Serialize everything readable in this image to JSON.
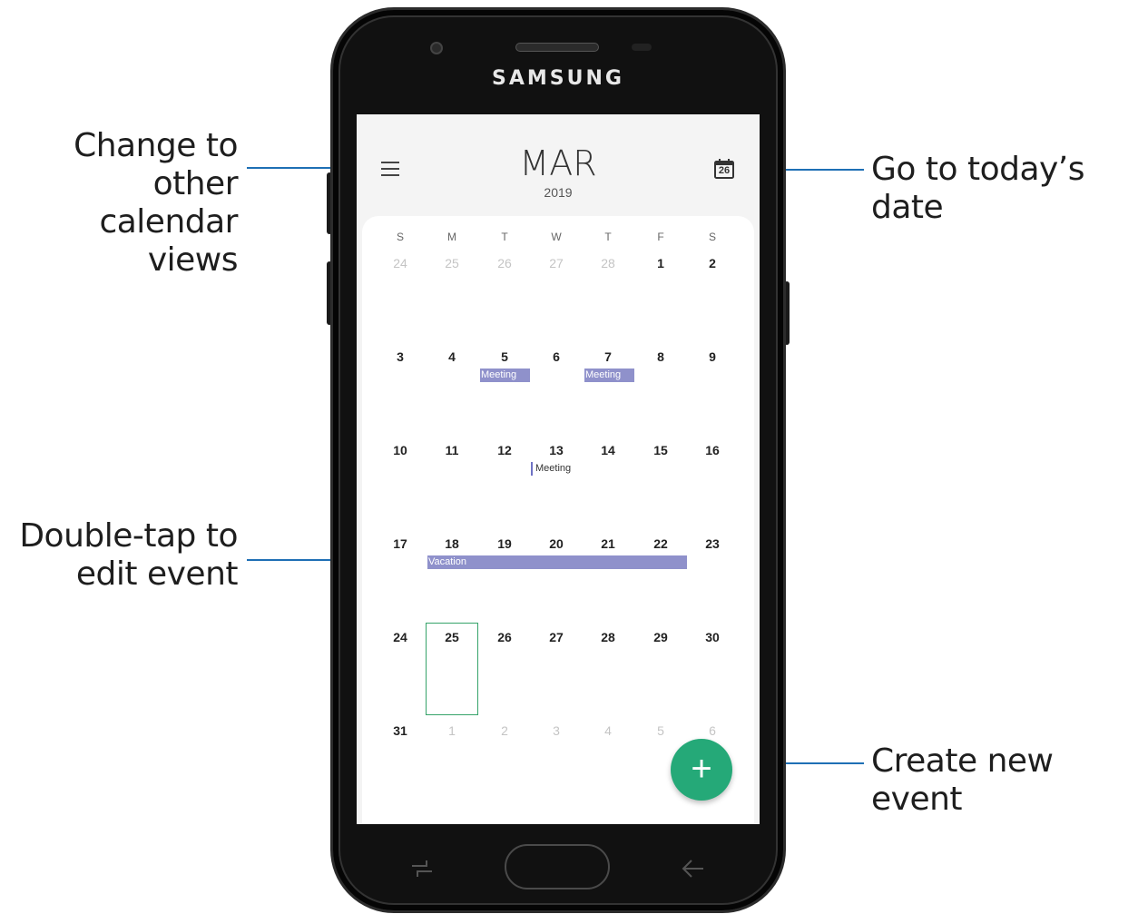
{
  "callouts": {
    "change_view": [
      "Change to other",
      "calendar views"
    ],
    "today": "Go to today’s date",
    "edit_event": [
      "Double-tap to",
      "edit event"
    ],
    "create_event": "Create new event"
  },
  "phone": {
    "brand": "SAMSUNG"
  },
  "calendar": {
    "month": "MAR",
    "year": "2019",
    "today_icon_number": "26",
    "weekdays": [
      "S",
      "M",
      "T",
      "W",
      "T",
      "F",
      "S"
    ],
    "weeks": [
      [
        "24",
        "25",
        "26",
        "27",
        "28",
        "1",
        "2"
      ],
      [
        "3",
        "4",
        "5",
        "6",
        "7",
        "8",
        "9"
      ],
      [
        "10",
        "11",
        "12",
        "13",
        "14",
        "15",
        "16"
      ],
      [
        "17",
        "18",
        "19",
        "20",
        "21",
        "22",
        "23"
      ],
      [
        "24",
        "25",
        "26",
        "27",
        "28",
        "29",
        "30"
      ],
      [
        "31",
        "1",
        "2",
        "3",
        "4",
        "5",
        "6"
      ]
    ],
    "events": {
      "meeting_5": "Meeting",
      "meeting_7": "Meeting",
      "meeting_13": "Meeting",
      "vacation": "Vacation"
    },
    "fab_label": "+"
  },
  "colors": {
    "accent_green": "#25a978",
    "event_purple": "#8f91cb",
    "callout_line": "#1e6fb5"
  }
}
